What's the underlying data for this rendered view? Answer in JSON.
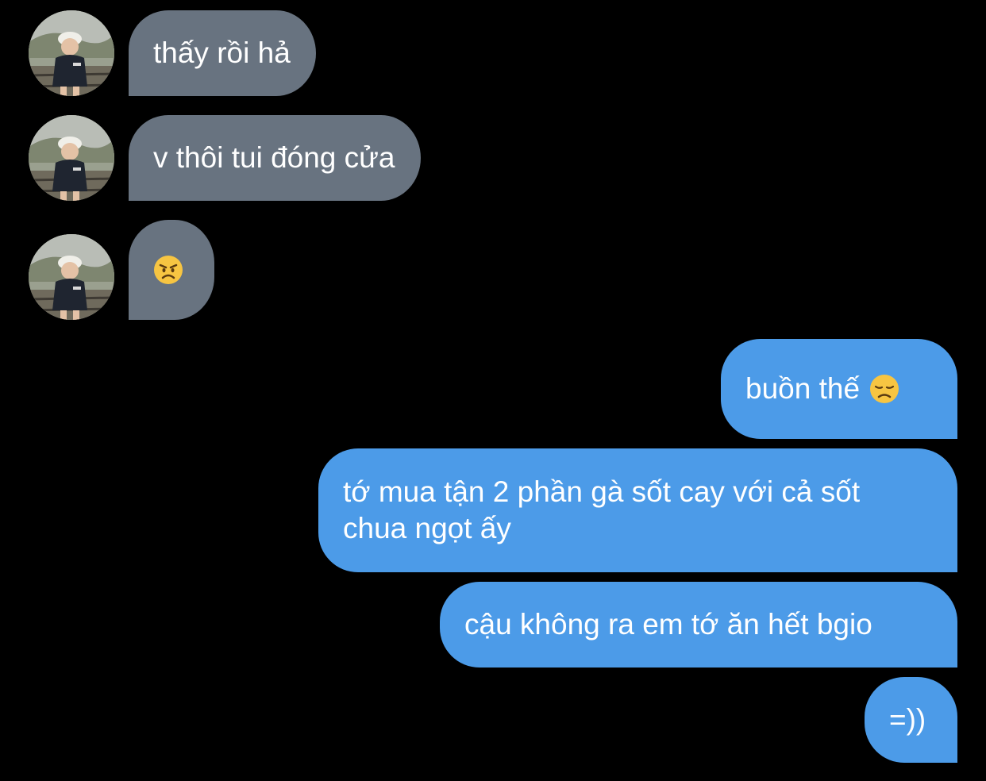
{
  "conversation": {
    "incoming": [
      {
        "text": "thấy rồi hả"
      },
      {
        "text": "v thôi tui đóng cửa"
      },
      {
        "text": "",
        "emoji": "angry-face-icon"
      }
    ],
    "outgoing": [
      {
        "text": "buồn thế",
        "emoji": "disappointed-face-icon"
      },
      {
        "text": "tớ mua tận 2 phần gà sốt cay với cả sốt chua ngọt ấy"
      },
      {
        "text": "cậu không ra em tớ ăn hết bgio"
      },
      {
        "text": "=))"
      }
    ]
  },
  "colors": {
    "background": "#000000",
    "incoming_bubble": "#687380",
    "outgoing_bubble": "#4c9be8",
    "text": "#ffffff"
  }
}
